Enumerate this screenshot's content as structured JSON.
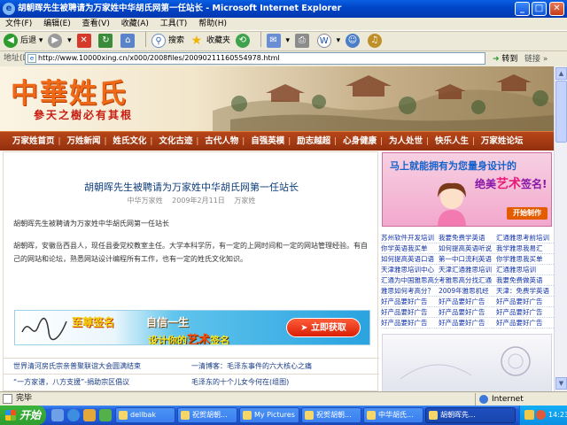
{
  "window": {
    "title": "胡朝晖先生被聘请为万家姓中华胡氏网第一任站长 - Microsoft Internet Explorer",
    "buttons": {
      "minimize": "_",
      "maximize": "□",
      "close": "✕"
    }
  },
  "menu": [
    "文件(F)",
    "编辑(E)",
    "查看(V)",
    "收藏(A)",
    "工具(T)",
    "帮助(H)"
  ],
  "toolbar": {
    "back": "后退",
    "search": "搜索",
    "favorites": "收藏夹"
  },
  "address": {
    "label": "地址(D)",
    "url": "http://www.10000xing.cn/x000/2008files/20090211160554978.html",
    "go": "转到",
    "links": "链接"
  },
  "banner": {
    "logo": "中華姓氏",
    "slogan": "參天之樹必有其根"
  },
  "nav": [
    "万家姓首页",
    "万姓新闻",
    "姓氏文化",
    "文化古迹",
    "古代人物",
    "自强英模",
    "励志越超",
    "心身健康",
    "为人处世",
    "快乐人生",
    "万家姓论坛"
  ],
  "article": {
    "title": "胡朝晖先生被聘请为万家姓中华胡氏网第一任站长",
    "meta": [
      "中华万家姓",
      "2009年2月11日",
      "万家姓"
    ],
    "para1": "胡朝晖先生被聘请为万家姓中华胡氏网第一任站长",
    "para2": "胡朝晖，安徽岳西县人，现任县委党校教室主任。大学本科学历，有一定的上网时间和一定的网站管理经验。有自己的网站和论坛，熟悉网站设计编程所有工作，也有一定的姓氏文化知识。"
  },
  "signature_ad": {
    "t1": "至尊签名",
    "t2": "自信一生",
    "t3a": "设计你的",
    "t3b": "艺术",
    "t3c": "签名",
    "button": "立即获取"
  },
  "bottom_links": [
    [
      "世界清河房氏宗亲普聚联谊大会圆满结束",
      "一清博客：毛泽东事件的六大核心之痛"
    ],
    [
      "“一方家谱，八方支援”-捐助宗区倡议",
      "毛泽东的十个儿女今何在(组图)"
    ]
  ],
  "right_ad": {
    "line1a": "马上就能拥有为您量身设计的",
    "line2a": "绝美",
    "line2b": "艺术",
    "line2c": "签名!",
    "button": "开始制作"
  },
  "right_links": [
    [
      "苏州软件开发培训",
      "我要免费学英语",
      "汇通雅思考前培训"
    ],
    [
      "你学英语我买单",
      "如何提高英语听说",
      "我学雅思我易汇"
    ],
    [
      "如何提高英语口语",
      "第一中口流利英语",
      "你学雅思我买单"
    ],
    [
      "天津雅思培训中心",
      "天津汇通雅思培训",
      "汇通雅思培训"
    ],
    [
      "汇通为中国雅思高分",
      "考雅思高分找汇通",
      "我要免费做英语"
    ],
    [
      "雅思如何考高分？",
      "2009年雅思机经",
      "天津：免费学英语"
    ],
    [
      "好产品要好广告",
      "好产品要好广告",
      "好产品要好广告"
    ],
    [
      "好产品要好广告",
      "好产品要好广告",
      "好产品要好广告"
    ],
    [
      "好产品要好广告",
      "好产品要好广告",
      "好产品要好广告"
    ]
  ],
  "status": {
    "text": "完毕",
    "zone": "Internet"
  },
  "taskbar": {
    "start": "开始",
    "tasks": [
      "dellbak",
      "祝贺胡朝...",
      "My Pictures",
      "祝贺胡朝...",
      "中华胡氏...",
      "胡朝晖先..."
    ],
    "clock": "14:23"
  },
  "colors": {
    "nav_bg": "#a23a12",
    "title_blue": "#0146c8",
    "logo_orange": "#ee6a19",
    "link_blue": "#193d87"
  }
}
